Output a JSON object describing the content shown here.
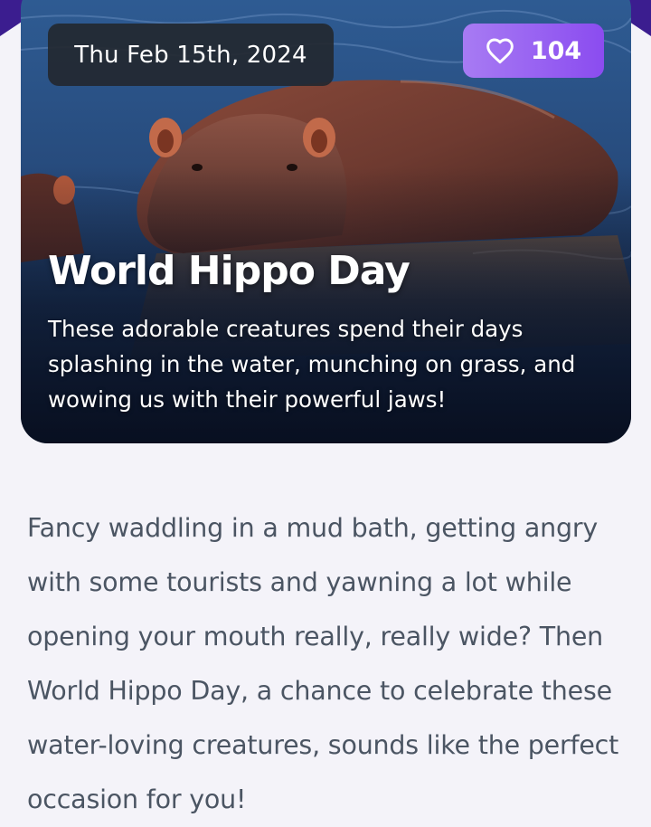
{
  "event": {
    "date": "Thu Feb 15th, 2024",
    "likes": "104",
    "title": "World Hippo Day",
    "subtitle": "These adorable creatures spend their days splashing in the water, munching on grass, and wowing us with their powerful jaws!",
    "image": "hippo-in-water-photo"
  },
  "article": {
    "body": "Fancy waddling in a mud bath, getting angry with some tourists and yawning a lot while opening your mouth really, really wide? Then World Hippo Day, a chance to celebrate these water-loving creatures, sounds like the perfect occasion for you!"
  },
  "icons": {
    "like": "heart-icon"
  },
  "colors": {
    "background": "#f4f3f9",
    "accent_purple": "#8b4cf0",
    "date_pill": "#23282f",
    "body_text": "#4b5563",
    "corner_accent": "#3b1d8f"
  }
}
